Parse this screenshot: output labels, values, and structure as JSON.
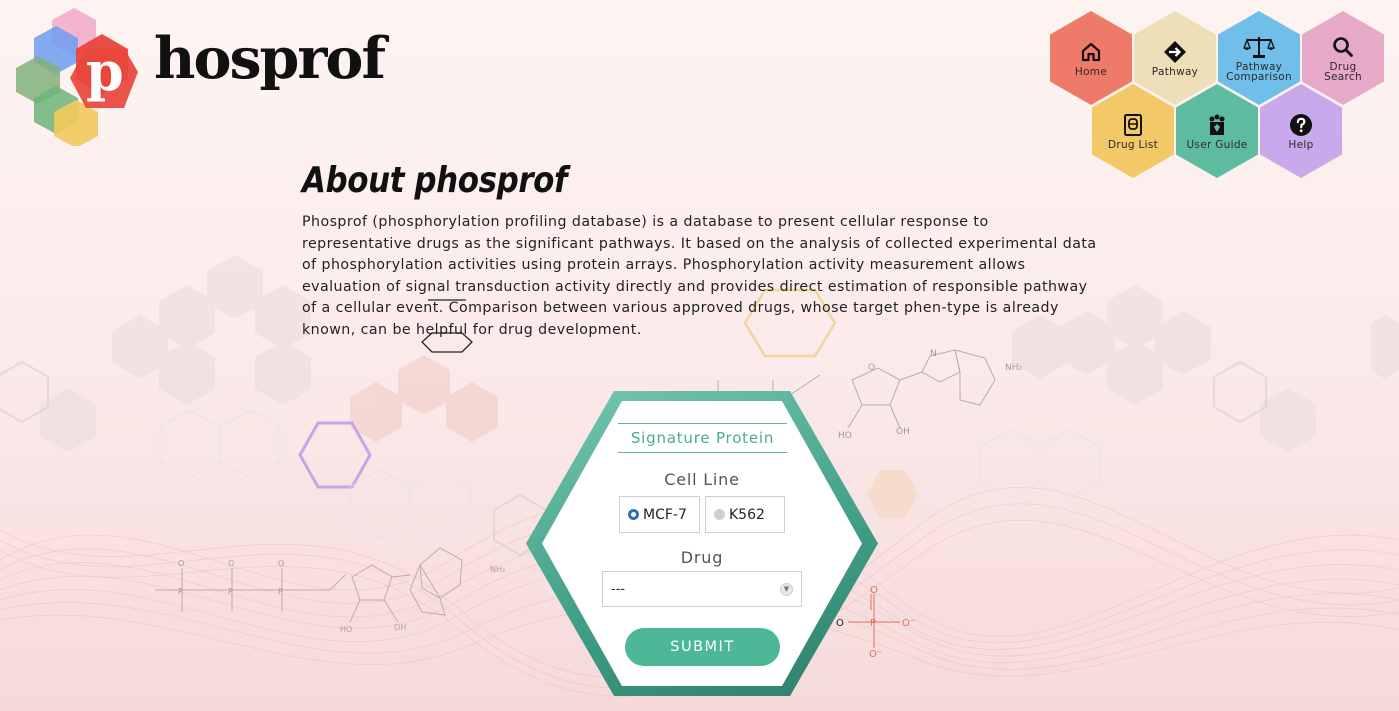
{
  "logo": {
    "initial": "p",
    "rest": "hosprof"
  },
  "nav": {
    "items": [
      {
        "label": "Home",
        "icon": "home-icon",
        "color": "#ee7b6a"
      },
      {
        "label": "Pathway",
        "icon": "pathway-arrow-icon",
        "color": "#efdfb9"
      },
      {
        "label": "Pathway\nComparison",
        "icon": "scales-icon",
        "color": "#6fbfea"
      },
      {
        "label": "Drug\nSearch",
        "icon": "search-icon",
        "color": "#e7a9c8"
      },
      {
        "label": "Drug List",
        "icon": "drug-list-icon",
        "color": "#f3c866"
      },
      {
        "label": "User Guide",
        "icon": "user-guide-icon",
        "color": "#5fbba0"
      },
      {
        "label": "Help",
        "icon": "help-icon",
        "color": "#c9a8ec"
      }
    ]
  },
  "about": {
    "title": "About phosprof",
    "body": "Phosprof (phosphorylation profiling database) is a database to present cellular response to representative drugs as the significant pathways. It based on the analysis of collected experimental data of phosphorylation activities using protein arrays. Phosphorylation activity measurement allows evaluation of signal transduction activity directly and provides direct estimation of responsible pathway of a cellular event. Comparison between various approved drugs, whose target phen-type is already known, can be helpful for drug development."
  },
  "form": {
    "title": "Signature Protein",
    "cell_line_label": "Cell Line",
    "cell_lines": [
      {
        "label": "MCF-7",
        "selected": true
      },
      {
        "label": "K562",
        "selected": false
      }
    ],
    "drug_label": "Drug",
    "drug_selected": "---",
    "submit_label": "SUBMIT"
  },
  "background_chem": {
    "nh2": "NH₂",
    "ho": "HO",
    "oh": "OH",
    "n": "N",
    "o": "O",
    "p": "P",
    "o_minus": "O⁻"
  },
  "theme": {
    "accent": "#4cb898",
    "logo_red": "#e8453c"
  }
}
